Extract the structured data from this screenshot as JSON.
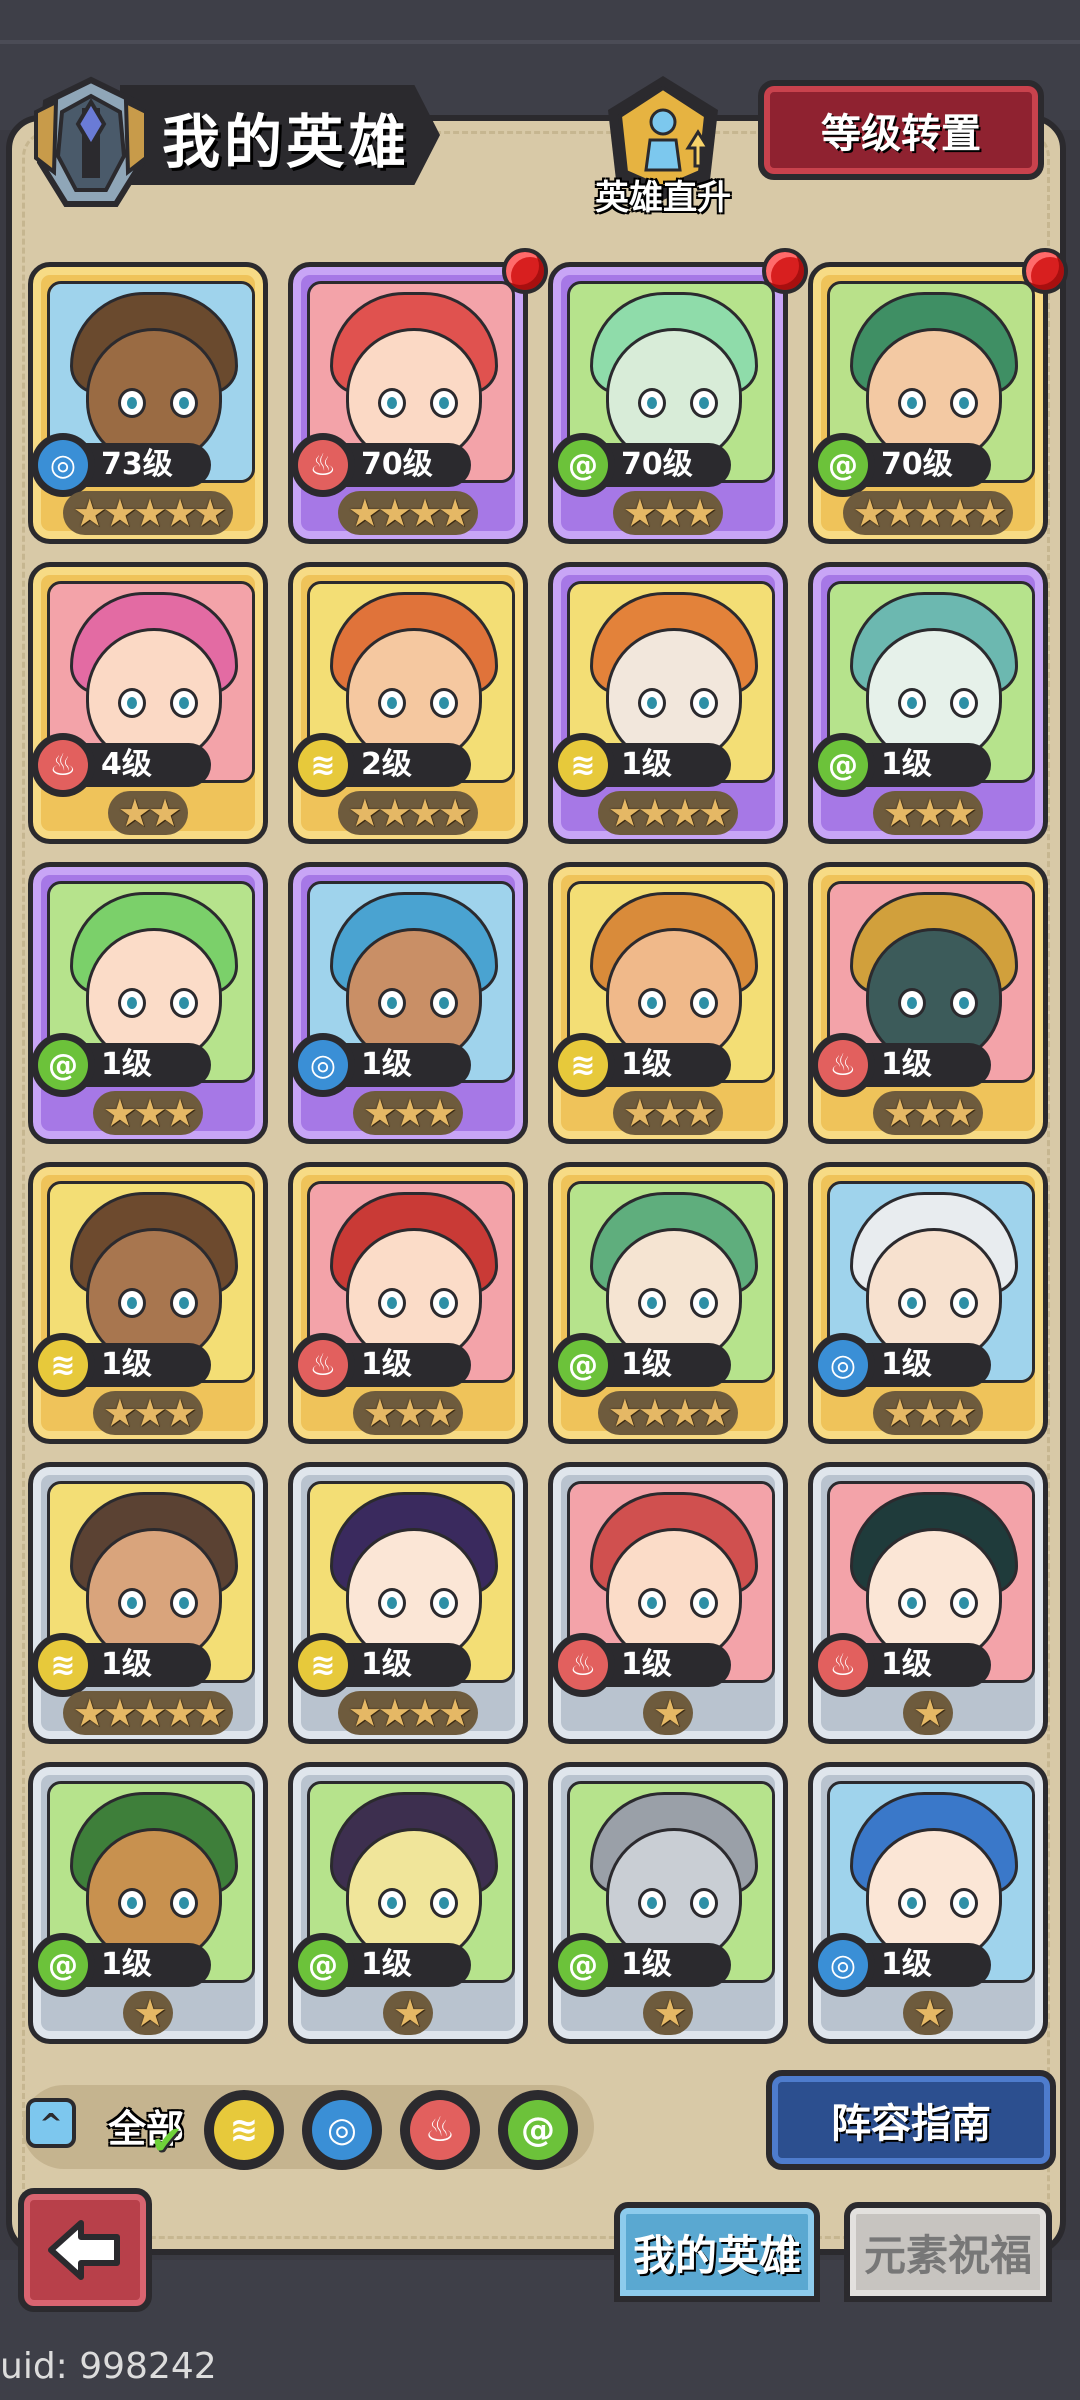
{
  "header": {
    "title": "我的英雄",
    "promote_label": "英雄直升",
    "level_reset_label": "等级转置"
  },
  "colors": {
    "gold": "#efc35a",
    "purple": "#a678e6",
    "silver": "#b9c3cf",
    "red_button": "#8f2230",
    "blue_button": "#2c4f8f"
  },
  "elements": {
    "water": {
      "icon": "water-drop-icon",
      "color": "#3a8fd6"
    },
    "fire": {
      "icon": "flame-icon",
      "color": "#e2605e"
    },
    "wind": {
      "icon": "wind-swirl-icon",
      "color": "#6cc23a"
    },
    "earth": {
      "icon": "earth-cloud-icon",
      "color": "#e7c93b"
    }
  },
  "heroes": [
    {
      "level": "73级",
      "stars": 5,
      "element": "water",
      "frame": "gold",
      "badge": false,
      "skin": "#9a6b43",
      "hair": "#6a4a2e",
      "bg": "#9fd3ec"
    },
    {
      "level": "70级",
      "stars": 4,
      "element": "fire",
      "frame": "purple",
      "badge": true,
      "skin": "#fbd9c5",
      "hair": "#e0524f",
      "bg": "#f3a3a9"
    },
    {
      "level": "70级",
      "stars": 3,
      "element": "wind",
      "frame": "purple",
      "badge": true,
      "skin": "#d8ecd8",
      "hair": "#8fdcaa",
      "bg": "#b6e38c"
    },
    {
      "level": "70级",
      "stars": 5,
      "element": "wind",
      "frame": "gold",
      "badge": true,
      "skin": "#f3c9a3",
      "hair": "#3f8f64",
      "bg": "#b9e18a"
    },
    {
      "level": "4级",
      "stars": 2,
      "element": "fire",
      "frame": "gold",
      "badge": false,
      "skin": "#fbd9c5",
      "hair": "#e36ba3",
      "bg": "#f3a3a9"
    },
    {
      "level": "2级",
      "stars": 4,
      "element": "earth",
      "frame": "gold",
      "badge": false,
      "skin": "#f5c8a0",
      "hair": "#e0733a",
      "bg": "#f3de75"
    },
    {
      "level": "1级",
      "stars": 4,
      "element": "earth",
      "frame": "purple",
      "badge": false,
      "skin": "#f2e7dc",
      "hair": "#e3823a",
      "bg": "#f3de75"
    },
    {
      "level": "1级",
      "stars": 3,
      "element": "wind",
      "frame": "purple",
      "badge": false,
      "skin": "#e6f1ea",
      "hair": "#6cb8b0",
      "bg": "#b6e38c"
    },
    {
      "level": "1级",
      "stars": 3,
      "element": "wind",
      "frame": "purple",
      "badge": false,
      "skin": "#fbdcc8",
      "hair": "#7bd06a",
      "bg": "#b6e38c"
    },
    {
      "level": "1级",
      "stars": 3,
      "element": "water",
      "frame": "purple",
      "badge": false,
      "skin": "#c98f66",
      "hair": "#4aa3d1",
      "bg": "#9fd3ec"
    },
    {
      "level": "1级",
      "stars": 3,
      "element": "earth",
      "frame": "gold",
      "badge": false,
      "skin": "#f0b98a",
      "hair": "#d98b3a",
      "bg": "#f3de75"
    },
    {
      "level": "1级",
      "stars": 3,
      "element": "fire",
      "frame": "gold",
      "badge": false,
      "skin": "#3c5b5a",
      "hair": "#d1a03c",
      "bg": "#f3a3a9"
    },
    {
      "level": "1级",
      "stars": 3,
      "element": "earth",
      "frame": "gold",
      "badge": false,
      "skin": "#a8764f",
      "hair": "#6d4a2e",
      "bg": "#f3de75"
    },
    {
      "level": "1级",
      "stars": 3,
      "element": "fire",
      "frame": "gold",
      "badge": false,
      "skin": "#fbdcc8",
      "hair": "#c93a36",
      "bg": "#f3a3a9"
    },
    {
      "level": "1级",
      "stars": 4,
      "element": "wind",
      "frame": "gold",
      "badge": false,
      "skin": "#f5e4d2",
      "hair": "#5fae7d",
      "bg": "#b6e38c"
    },
    {
      "level": "1级",
      "stars": 3,
      "element": "water",
      "frame": "gold",
      "badge": false,
      "skin": "#f7e1cf",
      "hair": "#e8ecef",
      "bg": "#9fd3ec"
    },
    {
      "level": "1级",
      "stars": 5,
      "element": "earth",
      "frame": "silver",
      "badge": false,
      "skin": "#d9a47c",
      "hair": "#5b4233",
      "bg": "#f3de75"
    },
    {
      "level": "1级",
      "stars": 4,
      "element": "earth",
      "frame": "silver",
      "badge": false,
      "skin": "#fbe6d6",
      "hair": "#3a2a5e",
      "bg": "#f3de75"
    },
    {
      "level": "1级",
      "stars": 1,
      "element": "fire",
      "frame": "silver",
      "badge": false,
      "skin": "#fbdcc8",
      "hair": "#d0504f",
      "bg": "#f3a3a9"
    },
    {
      "level": "1级",
      "stars": 1,
      "element": "fire",
      "frame": "silver",
      "badge": false,
      "skin": "#fbe6d6",
      "hair": "#1f3b3b",
      "bg": "#f3a3a9"
    },
    {
      "level": "1级",
      "stars": 1,
      "element": "wind",
      "frame": "silver",
      "badge": false,
      "skin": "#c8914f",
      "hair": "#3e7f3a",
      "bg": "#b6e38c"
    },
    {
      "level": "1级",
      "stars": 1,
      "element": "wind",
      "frame": "silver",
      "badge": false,
      "skin": "#f0e59a",
      "hair": "#3d2f4f",
      "bg": "#b6e38c"
    },
    {
      "level": "1级",
      "stars": 1,
      "element": "wind",
      "frame": "silver",
      "badge": false,
      "skin": "#c9ced4",
      "hair": "#9aa0a8",
      "bg": "#b6e38c"
    },
    {
      "level": "1级",
      "stars": 1,
      "element": "water",
      "frame": "silver",
      "badge": false,
      "skin": "#fbe6d6",
      "hair": "#3a78c9",
      "bg": "#9fd3ec"
    }
  ],
  "filter": {
    "all_label": "全部",
    "icons": [
      "earth",
      "water",
      "fire",
      "wind"
    ]
  },
  "lineup_guide_label": "阵容指南",
  "tabs": {
    "my_heroes": "我的英雄",
    "element_blessing": "元素祝福"
  },
  "uid_text": "uid: 998242"
}
